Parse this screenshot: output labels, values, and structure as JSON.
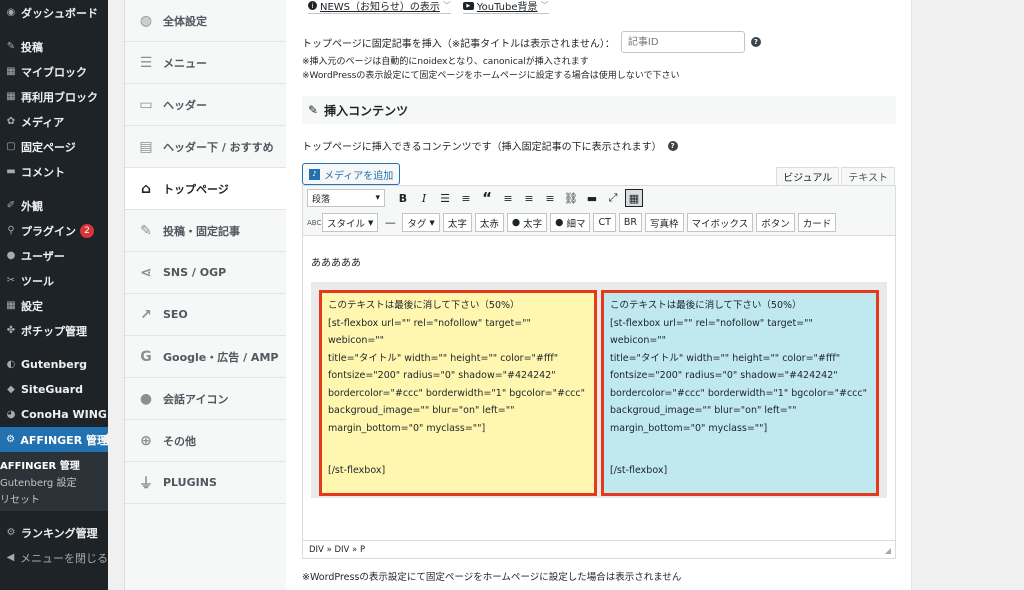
{
  "admin_menu": {
    "items": [
      {
        "icon": "dashboard-icon",
        "glyph": "◉",
        "label": "ダッシュボード"
      },
      {
        "sep": true
      },
      {
        "icon": "pin-icon",
        "glyph": "✎",
        "label": "投稿"
      },
      {
        "icon": "block-icon",
        "glyph": "▦",
        "label": "マイブロック"
      },
      {
        "icon": "reuse-block-icon",
        "glyph": "▦",
        "label": "再利用ブロック"
      },
      {
        "icon": "media-icon",
        "glyph": "✿",
        "label": "メディア"
      },
      {
        "icon": "page-icon",
        "glyph": "▢",
        "label": "固定ページ"
      },
      {
        "icon": "comment-icon",
        "glyph": "▬",
        "label": "コメント"
      },
      {
        "sep": true
      },
      {
        "icon": "appearance-icon",
        "glyph": "✐",
        "label": "外観"
      },
      {
        "icon": "plugin-icon",
        "glyph": "⚲",
        "label": "プラグイン",
        "badge": "2"
      },
      {
        "icon": "user-icon",
        "glyph": "●",
        "label": "ユーザー"
      },
      {
        "icon": "tool-icon",
        "glyph": "✂",
        "label": "ツール"
      },
      {
        "icon": "settings-icon",
        "glyph": "▦",
        "label": "設定"
      },
      {
        "icon": "paw-icon",
        "glyph": "✤",
        "label": "ポチップ管理"
      },
      {
        "sep": true
      },
      {
        "icon": "gutenberg-icon",
        "glyph": "◐",
        "label": "Gutenberg"
      },
      {
        "icon": "siteguard-icon",
        "glyph": "◆",
        "label": "SiteGuard"
      },
      {
        "icon": "conoha-icon",
        "glyph": "◕",
        "label": "ConoHa WING"
      },
      {
        "icon": "gear-icon",
        "glyph": "⚙",
        "label": "AFFINGER 管理",
        "active": true
      }
    ],
    "submenu": [
      {
        "label": "AFFINGER 管理",
        "current": true
      },
      {
        "label": "Gutenberg 設定"
      },
      {
        "label": "リセット"
      }
    ],
    "after": [
      {
        "icon": "gear-icon",
        "glyph": "⚙",
        "label": "ランキング管理"
      },
      {
        "icon": "collapse-icon",
        "glyph": "◀",
        "label": "メニューを閉じる",
        "collapse": true
      }
    ]
  },
  "settings_nav": [
    {
      "icon": "palette-icon",
      "glyph": "◍",
      "label": "全体設定"
    },
    {
      "icon": "menu-icon",
      "glyph": "☰",
      "label": "メニュー"
    },
    {
      "icon": "header-icon",
      "glyph": "▭",
      "label": "ヘッダー"
    },
    {
      "icon": "header-below-icon",
      "glyph": "▤",
      "label": "ヘッダー下 / おすすめ"
    },
    {
      "icon": "home-icon",
      "glyph": "⌂",
      "label": "トップページ",
      "active": true
    },
    {
      "icon": "edit-icon",
      "glyph": "✎",
      "label": "投稿・固定記事"
    },
    {
      "icon": "share-icon",
      "glyph": "⋖",
      "label": "SNS / OGP"
    },
    {
      "icon": "chart-icon",
      "glyph": "↗",
      "label": "SEO"
    },
    {
      "icon": "google-icon",
      "glyph": "G",
      "label": "Google・広告 / AMP"
    },
    {
      "icon": "chat-icon",
      "glyph": "●",
      "label": "会話アイコン"
    },
    {
      "icon": "plus-circle-icon",
      "glyph": "⊕",
      "label": "その他"
    },
    {
      "icon": "plug-icon",
      "glyph": "⏚",
      "label": "PLUGINS"
    }
  ],
  "top_links": [
    {
      "label": "NEWS（お知らせ）の表示"
    },
    {
      "label": "YouTube背景"
    }
  ],
  "fixed": {
    "label": "トップページに固定記事を挿入（※記事タイトルは表示されません）：",
    "placeholder": "記事ID",
    "note1": "※挿入元のページは自動的にnoidexとなり、canonicalが挿入されます",
    "note2": "※WordPressの表示設定にて固定ページをホームページに設定する場合は使用しないで下さい"
  },
  "section": {
    "title": "挿入コンテンツ",
    "desc": "トップページに挿入できるコンテンツです（挿入固定記事の下に表示されます）"
  },
  "editor": {
    "media_button": "メディアを追加",
    "tabs": [
      "ビジュアル",
      "テキスト"
    ],
    "format_select": "段落",
    "toolbar2": [
      "スタイル",
      "タグ",
      "太字",
      "太赤",
      "太字",
      "細マ",
      "CT",
      "BR",
      "写真枠",
      "マイボックス",
      "ボタン",
      "カード"
    ],
    "body_text": "あああああ",
    "box_left": {
      "heading": "このテキストは最後に消して下さい（50%）",
      "code": "[st-flexbox url=\"\" rel=\"nofollow\" target=\"\" webicon=\"\"\ntitle=\"タイトル\" width=\"\" height=\"\" color=\"#fff\"\nfontsize=\"200\" radius=\"0\" shadow=\"#424242\"\nbordercolor=\"#ccc\" borderwidth=\"1\" bgcolor=\"#ccc\"\nbackgroud_image=\"\" blur=\"on\" left=\"\"\nmargin_bottom=\"0\" myclass=\"\"]",
      "end": "[/st-flexbox]"
    },
    "box_right": {
      "heading": "このテキストは最後に消して下さい（50%）",
      "code": "[st-flexbox url=\"\" rel=\"nofollow\" target=\"\" webicon=\"\"\ntitle=\"タイトル\" width=\"\" height=\"\" color=\"#fff\"\nfontsize=\"200\" radius=\"0\" shadow=\"#424242\"\nbordercolor=\"#ccc\" borderwidth=\"1\" bgcolor=\"#ccc\"\nbackgroud_image=\"\" blur=\"on\" left=\"\"\nmargin_bottom=\"0\" myclass=\"\"]",
      "end": "[/st-flexbox]"
    },
    "status_path": "DIV » DIV » P"
  },
  "footer_note": "※WordPressの表示設定にて固定ページをホームページに設定した場合は表示されません",
  "colors": {
    "accent": "#2271b1",
    "box_border": "#e33a1e",
    "box_yellow": "#fff7b0",
    "box_blue": "#bfe8ef",
    "badge": "#d63638"
  }
}
